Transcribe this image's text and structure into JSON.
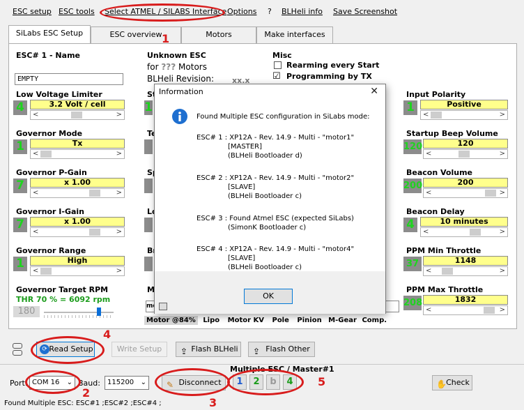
{
  "menu": {
    "esc_setup": "ESC setup",
    "esc_tools": "ESC tools",
    "select_interface": "Select ATMEL / SILABS Interface",
    "options": "Options",
    "help": "?",
    "blheli_info": "BLHeli info",
    "save_screenshot": "Save Screenshot"
  },
  "tabs": [
    "SiLabs ESC Setup",
    "ESC overview",
    "Motors",
    "Make interfaces"
  ],
  "esc": {
    "name_label": "ESC# 1 - Name",
    "name_value": "EMPTY",
    "unknown_title": "Unknown ESC",
    "for_line_prefix": "for",
    "for_line_qmarks": "???",
    "for_line_suffix": "Motors",
    "blheli_revision_label": "BLHeli Revision:",
    "blheli_revision_value": "xx.x"
  },
  "misc": {
    "title": "Misc",
    "rearming": "Rearming every Start",
    "programming": "Programming by TX",
    "programming_checked": "☑"
  },
  "params_left": [
    {
      "label": "Low Voltage Limiter",
      "badge": "4",
      "value": "3.2 Volt / cell"
    },
    {
      "label": "Governor Mode",
      "badge": "1",
      "value": "Tx"
    },
    {
      "label": "Governor P-Gain",
      "badge": "7",
      "value": "x 1.00"
    },
    {
      "label": "Governor I-Gain",
      "badge": "7",
      "value": "x 1.00"
    },
    {
      "label": "Governor Range",
      "badge": "1",
      "value": "High"
    }
  ],
  "target_rpm": {
    "label": "Governor Target RPM",
    "value": "THR 70 % = 6092 rpm",
    "badge": "180"
  },
  "params_mid_partial": [
    "St",
    "Te",
    "Sp",
    "Lo",
    "Br",
    "M"
  ],
  "params_right": [
    {
      "label": "Input Polarity",
      "badge": "1",
      "value": "Positive"
    },
    {
      "label": "Startup Beep Volume",
      "badge": "120",
      "value": "120"
    },
    {
      "label": "Beacon Volume",
      "badge": "200",
      "value": "200"
    },
    {
      "label": "Beacon Delay",
      "badge": "4",
      "value": "10 minutes"
    },
    {
      "label": "PPM Min Throttle",
      "badge": "37",
      "value": "1148"
    },
    {
      "label": "PPM Max Throttle",
      "badge": "208",
      "value": "1832"
    }
  ],
  "motor_row": {
    "field_prefix": "mo",
    "cols": [
      "Motor @84%",
      "Lipo",
      "Motor KV",
      "Pole",
      "Pinion",
      "M-Gear",
      "Comp."
    ]
  },
  "dialog": {
    "title": "Information",
    "heading": "Found Multiple ESC configuration in SiLabs mode:",
    "lines": [
      "ESC# 1 : XP12A - Rev. 14.9 - Multi - \"motor1\"",
      "[MASTER]",
      "(BLHeli Bootloader d)",
      "ESC# 2 : XP12A - Rev. 14.9 - Multi - \"motor2\"",
      "[SLAVE]",
      "(BLHeli Bootloader c)",
      "ESC# 3 : Found Atmel ESC (expected SiLabs)",
      "(SimonK Bootloader c)",
      "ESC# 4 : XP12A - Rev. 14.9 - Multi - \"motor4\"",
      "[SLAVE]",
      "(BLHeli Bootloader c)"
    ],
    "ok": "OK"
  },
  "toolbar": {
    "read_setup": "Read Setup",
    "write_setup": "Write Setup",
    "flash_blheli": "Flash BLHeli",
    "flash_other": "Flash Other"
  },
  "bottom": {
    "port_label": "Port:",
    "port_value": "COM 16",
    "baud_label": "Baud:",
    "baud_value": "115200",
    "disconnect": "Disconnect",
    "multi_title": "Multiple ESC / Master#1",
    "esc_buttons": [
      "1",
      "2",
      "b",
      "4"
    ],
    "check": "Check"
  },
  "status_text": "Found Multiple ESC: ESC#1 ;ESC#2 ;ESC#4 ;",
  "annotations": [
    "1",
    "2",
    "3",
    "4",
    "5"
  ],
  "colors": {
    "accent_red": "#d81c1c",
    "value_yellow": "#ffff8c",
    "badge_green": "#1fd31f"
  }
}
